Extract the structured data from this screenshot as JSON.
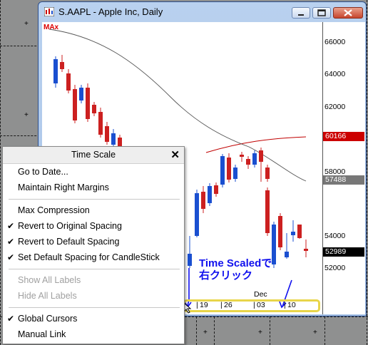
{
  "window": {
    "title": "S.AAPL - Apple Inc, Daily",
    "max_label": "MAx"
  },
  "axis": {
    "ticks": [
      "66000",
      "64000",
      "62000",
      "58000",
      "54000",
      "52000"
    ],
    "markers": [
      {
        "label": "60166",
        "color": "#cc0000",
        "text_color": "#ffffff"
      },
      {
        "label": "57488",
        "color": "#777777",
        "text_color": "#ffffff"
      },
      {
        "label": "52989",
        "color": "#000000",
        "text_color": "#ffffff"
      }
    ],
    "time_labels": [
      "19",
      "26",
      "03",
      "10"
    ],
    "month_label": "Dec"
  },
  "context_menu": {
    "title": "Time Scale",
    "items": [
      {
        "label": "Go to Date...",
        "checked": false,
        "enabled": true
      },
      {
        "label": "Maintain Right Margins",
        "checked": false,
        "enabled": true
      },
      {
        "label": "Max Compression",
        "checked": false,
        "enabled": true
      },
      {
        "label": "Revert to Original Spacing",
        "checked": true,
        "enabled": true
      },
      {
        "label": "Revert to Default Spacing",
        "checked": true,
        "enabled": true
      },
      {
        "label": "Set Default Spacing for CandleStick",
        "checked": true,
        "enabled": true
      },
      {
        "label": "Show All Labels",
        "checked": false,
        "enabled": false
      },
      {
        "label": "Hide All Labels",
        "checked": false,
        "enabled": false
      },
      {
        "label": "Global Cursors",
        "checked": true,
        "enabled": true
      },
      {
        "label": "Manual Link",
        "checked": false,
        "enabled": true
      }
    ]
  },
  "annotation": {
    "line1": "Time Scaledで",
    "line2": "右クリック"
  },
  "colors": {
    "up_candle": "#1a4fd0",
    "down_candle": "#cc2020",
    "ma_long": "#c00000",
    "ma_short": "#555555",
    "highlight": "#e8d54a",
    "annotation": "#1010ee"
  }
}
